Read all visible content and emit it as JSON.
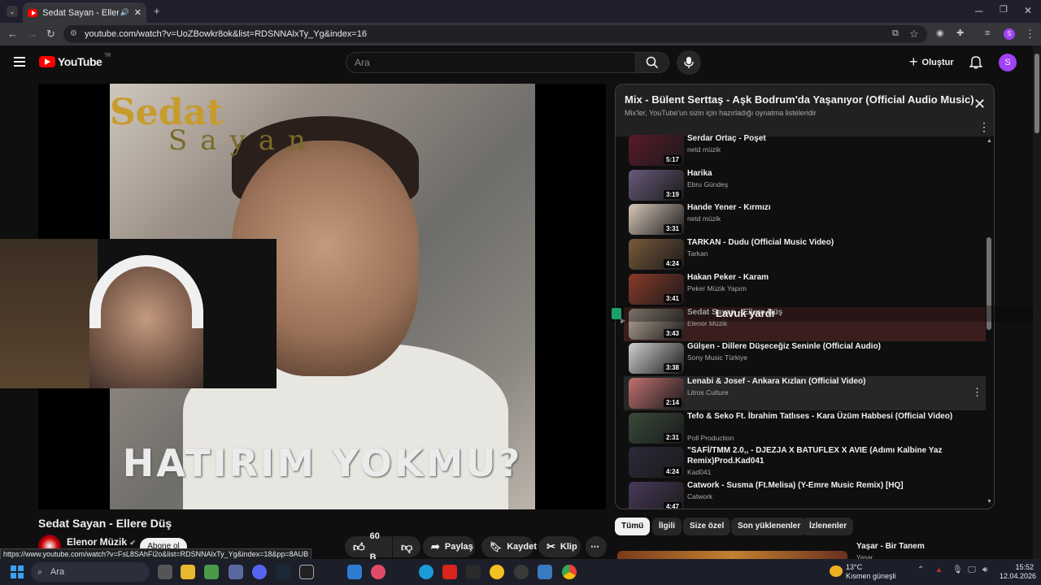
{
  "browser": {
    "tab_title": "Sedat Sayan - Ellere Düş - Y",
    "url": "youtube.com/watch?v=UoZBowkr8ok&list=RDSNNAlxTy_Yg&index=16",
    "status_url": "https://www.youtube.com/watch?v=FsL8SAhFi2o&list=RDSNNAlxTy_Yg&index=18&pp=8AUB",
    "profile_initial": "S"
  },
  "masthead": {
    "logo_text": "YouTube",
    "logo_region": "TR",
    "search_placeholder": "Ara",
    "create_label": "Oluştur",
    "avatar_initial": "S"
  },
  "video": {
    "cover_artist_top": "Sedat",
    "cover_artist_bottom": "Sayan",
    "cover_title": "HATIRIM YOKMU?",
    "title": "Sedat Sayan - Ellere Düş",
    "channel": "Elenor Müzik",
    "subscribe_label": "Abone ol",
    "likes": "60 B",
    "share_label": "Paylaş",
    "save_label": "Kaydet",
    "clip_label": "Klip"
  },
  "playlist": {
    "title": "Mix - Bülent Serttaş - Aşk Bodrum'da Yaşanıyor (Official Audio Music)",
    "subtitle": "Mix'ler, YouTube'un sizin için hazırladığı oynatma listeleridir",
    "items": [
      {
        "title": "Serdar Ortaç - Poşet",
        "channel": "netd müzik",
        "duration": "5:17",
        "thumb": "#5a1a2a"
      },
      {
        "title": "Harika",
        "channel": "Ebru Gündeş",
        "duration": "3:19",
        "thumb": "#6a5a7a"
      },
      {
        "title": "Hande Yener - Kırmızı",
        "channel": "netd müzik",
        "duration": "3:31",
        "thumb": "#d8c8b8"
      },
      {
        "title": "TARKAN - Dudu (Official Music Video)",
        "channel": "Tarkan",
        "duration": "4:24",
        "thumb": "#7a5a3a"
      },
      {
        "title": "Hakan Peker - Karam",
        "channel": "Peker Müzik Yapım",
        "duration": "3:41",
        "thumb": "#8a3a2a"
      },
      {
        "title": "Sedat Sayan - Ellere Düş",
        "channel": "Elenor Müzik",
        "duration": "3:43",
        "thumb": "#b8a898",
        "active": true
      },
      {
        "title": "Gülşen - Dillere Düşeceğiz Seninle (Official Audio)",
        "channel": "Sony Music Türkiye",
        "duration": "3:38",
        "thumb": "#d0d0d0"
      },
      {
        "title": "Lenabi & Josef - Ankara Kızları (Official Video)",
        "channel": "Litros Culture",
        "duration": "2:14",
        "thumb": "#c07070",
        "hover": true
      },
      {
        "title": "Tefo & Seko Ft. İbrahim Tatlıses - Kara Üzüm Habbesi (Official Video)",
        "channel": "Poll Production",
        "duration": "2:31",
        "thumb": "#3a4a3a"
      },
      {
        "title": "\"SAFİ/TMM 2.0,, - DJEZJA X BATUFLEX X AVIE (Adımı Kalbine Yaz Remix)Prod.Kad041",
        "channel": "Kad041",
        "duration": "4:24",
        "thumb": "#2a2a3a"
      },
      {
        "title": "Catwork - Susma (Ft.Melisa) (Y-Emre Music Remix) [HQ]",
        "channel": "Catwork",
        "duration": "4:47",
        "thumb": "#4a3a5a"
      }
    ]
  },
  "overlay_text": "Lavuk yardı",
  "chips": [
    "Tümü",
    "İlgili",
    "Size özel",
    "Son yüklenenler",
    "İzlenenler"
  ],
  "next_video": {
    "title": "Yaşar - Bir Tanem",
    "channel": "Yaşar"
  },
  "taskbar": {
    "search_placeholder": "Ara",
    "weather_temp": "13°C",
    "weather_text": "Kısmen güneşli",
    "time": "15:52",
    "date": "12.04.2026"
  }
}
